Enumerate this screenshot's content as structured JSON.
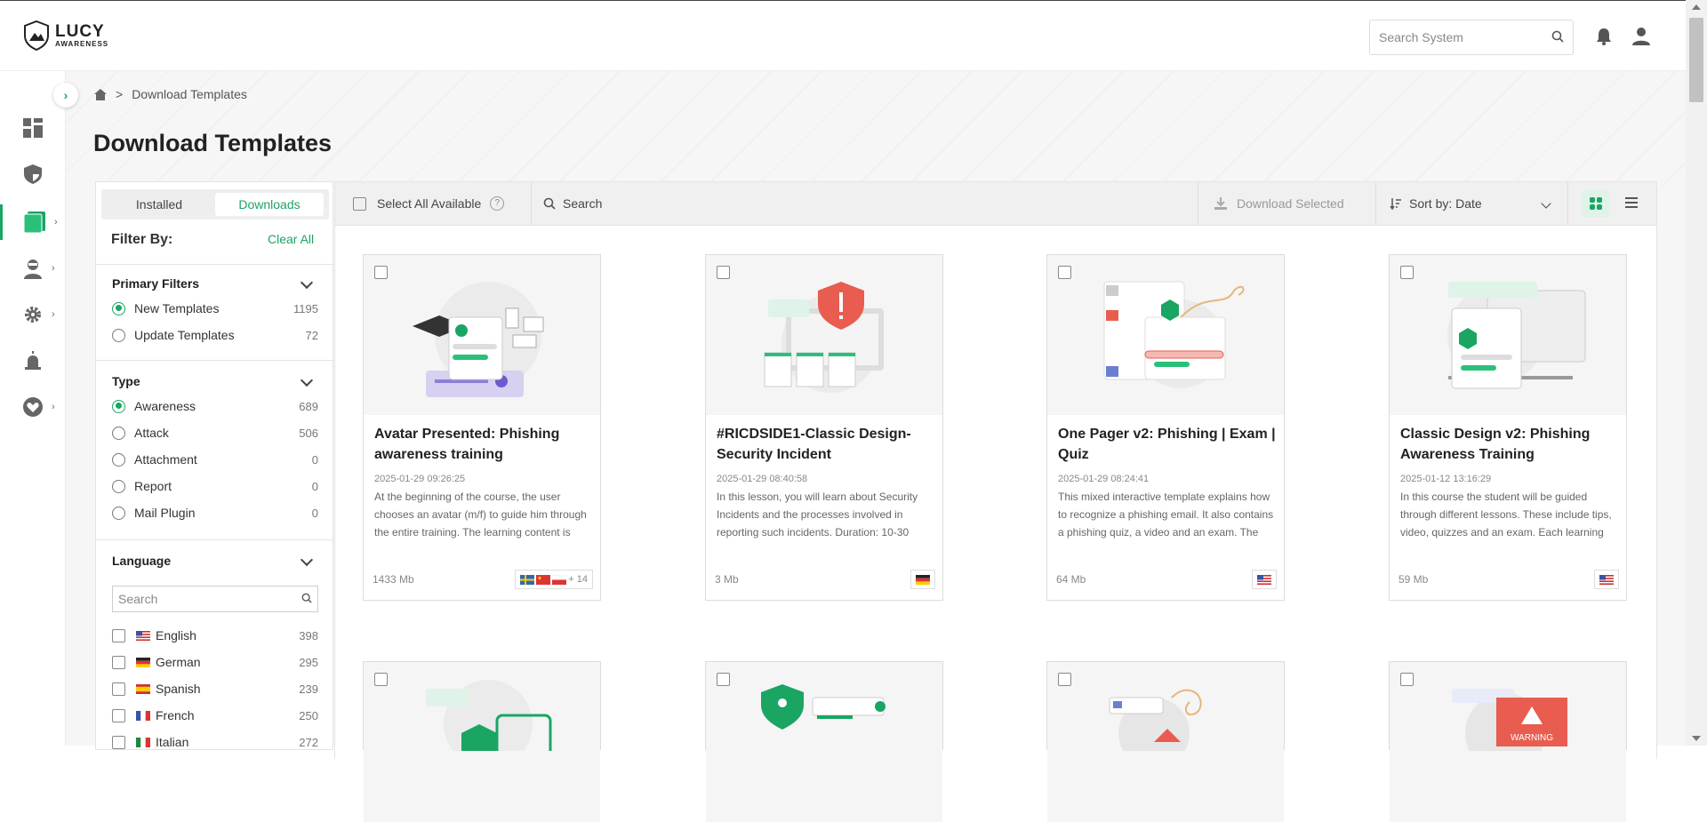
{
  "app": {
    "logo_line1": "LUCY",
    "logo_line2": "AWARENESS"
  },
  "header": {
    "search_placeholder": "Search System"
  },
  "breadcrumb": {
    "separator": ">",
    "current": "Download Templates"
  },
  "page": {
    "title": "Download Templates"
  },
  "filters": {
    "tabs": [
      "Installed",
      "Downloads"
    ],
    "active_tab": "Downloads",
    "filter_by": "Filter By:",
    "clear_all": "Clear All",
    "primary": {
      "title": "Primary Filters",
      "options": [
        {
          "label": "New Templates",
          "count": "1195",
          "selected": true
        },
        {
          "label": "Update Templates",
          "count": "72",
          "selected": false
        }
      ]
    },
    "type": {
      "title": "Type",
      "options": [
        {
          "label": "Awareness",
          "count": "689",
          "selected": true
        },
        {
          "label": "Attack",
          "count": "506",
          "selected": false
        },
        {
          "label": "Attachment",
          "count": "0",
          "selected": false
        },
        {
          "label": "Report",
          "count": "0",
          "selected": false
        },
        {
          "label": "Mail Plugin",
          "count": "0",
          "selected": false
        }
      ]
    },
    "language": {
      "title": "Language",
      "search_placeholder": "Search",
      "options": [
        {
          "label": "English",
          "count": "398",
          "flag": "us"
        },
        {
          "label": "German",
          "count": "295",
          "flag": "de"
        },
        {
          "label": "Spanish",
          "count": "239",
          "flag": "es"
        },
        {
          "label": "French",
          "count": "250",
          "flag": "fr"
        },
        {
          "label": "Italian",
          "count": "272",
          "flag": "it"
        }
      ]
    }
  },
  "toolbar": {
    "select_all": "Select All Available",
    "search_label": "Search",
    "download_selected": "Download Selected",
    "sort": "Sort by: Date"
  },
  "cards": [
    {
      "title": "Avatar Presented: Phishing awareness training",
      "date": "2025-01-29 09:26:25",
      "desc": "At the beginning of the course, the user chooses an avatar (m/f) to guide him through the entire training. The learning content is",
      "size": "1433 Mb",
      "extra": "+ 14",
      "flags": [
        "se",
        "cn",
        "pl"
      ]
    },
    {
      "title": "#RICDSIDE1-Classic Design-Security Incident",
      "date": "2025-01-29 08:40:58",
      "desc": "In this lesson, you will learn about Security Incidents and the processes involved in reporting such incidents. Duration: 10-30",
      "size": "3 Mb",
      "extra": "",
      "flags": [
        "de"
      ]
    },
    {
      "title": "One Pager v2: Phishing | Exam | Quiz",
      "date": "2025-01-29 08:24:41",
      "desc": "This mixed interactive template explains how to recognize a phishing email. It also contains a phishing quiz, a video and an exam. The",
      "size": "64 Mb",
      "extra": "",
      "flags": [
        "us"
      ]
    },
    {
      "title": "Classic Design v2: Phishing Awareness Training",
      "date": "2025-01-12 13:16:29",
      "desc": "In this course the student will be guided through different lessons. These include tips, video, quizzes and an exam. Each learning",
      "size": "59 Mb",
      "extra": "",
      "flags": [
        "us"
      ]
    }
  ],
  "colors": {
    "accent": "#1aa563",
    "warning": "#e85d50"
  }
}
